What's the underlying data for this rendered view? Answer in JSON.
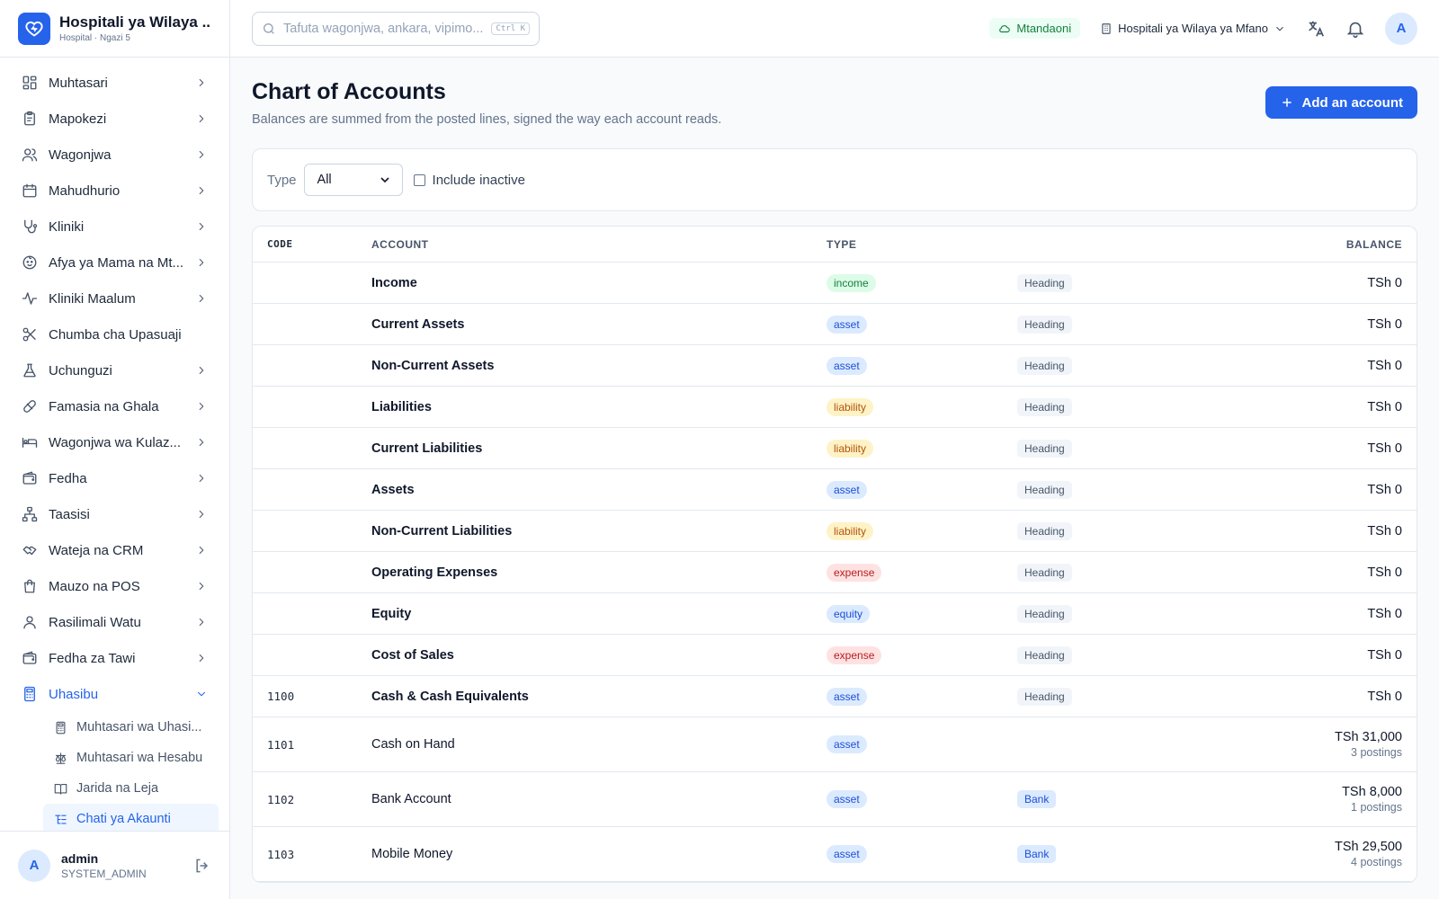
{
  "brand": {
    "title": "Hospitali ya Wilaya ...",
    "subtitle": "Hospital · Ngazi 5"
  },
  "sidebar": {
    "items": [
      {
        "label": "Muhtasari",
        "icon": "dashboard-icon",
        "chevron": true
      },
      {
        "label": "Mapokezi",
        "icon": "clipboard-icon",
        "chevron": true
      },
      {
        "label": "Wagonjwa",
        "icon": "users-icon",
        "chevron": true
      },
      {
        "label": "Mahudhurio",
        "icon": "calendar-icon",
        "chevron": true
      },
      {
        "label": "Kliniki",
        "icon": "stethoscope-icon",
        "chevron": true
      },
      {
        "label": "Afya ya Mama na Mt...",
        "icon": "baby-icon",
        "chevron": true
      },
      {
        "label": "Kliniki Maalum",
        "icon": "activity-icon",
        "chevron": true
      },
      {
        "label": "Chumba cha Upasuaji",
        "icon": "scissors-icon",
        "chevron": false
      },
      {
        "label": "Uchunguzi",
        "icon": "flask-icon",
        "chevron": true
      },
      {
        "label": "Famasia na Ghala",
        "icon": "pill-icon",
        "chevron": true
      },
      {
        "label": "Wagonjwa wa Kulaz...",
        "icon": "bed-icon",
        "chevron": true
      },
      {
        "label": "Fedha",
        "icon": "wallet-icon",
        "chevron": true
      },
      {
        "label": "Taasisi",
        "icon": "org-chart-icon",
        "chevron": true
      },
      {
        "label": "Wateja na CRM",
        "icon": "handshake-icon",
        "chevron": true
      },
      {
        "label": "Mauzo na POS",
        "icon": "shopping-bag-icon",
        "chevron": true
      },
      {
        "label": "Rasilimali Watu",
        "icon": "user-icon",
        "chevron": true
      },
      {
        "label": "Fedha za Tawi",
        "icon": "wallet-icon",
        "chevron": true
      },
      {
        "label": "Uhasibu",
        "icon": "calculator-icon",
        "chevron": true,
        "active": true
      }
    ],
    "subitems": [
      {
        "label": "Muhtasari wa Uhasi...",
        "icon": "calculator-icon"
      },
      {
        "label": "Muhtasari wa Hesabu",
        "icon": "scale-icon"
      },
      {
        "label": "Jarida na Leja",
        "icon": "book-icon"
      },
      {
        "label": "Chati ya Akaunti",
        "icon": "list-tree-icon",
        "active": true
      }
    ]
  },
  "user": {
    "initial": "A",
    "name": "admin",
    "role": "SYSTEM_ADMIN"
  },
  "topbar": {
    "search_placeholder": "Tafuta wagonjwa, ankara, vipimo...",
    "shortcut": "Ctrl K",
    "status": "Mtandaoni",
    "facility": "Hospitali ya Wilaya ya Mfano",
    "avatar": "A"
  },
  "page": {
    "title": "Chart of Accounts",
    "subtitle": "Balances are summed from the posted lines, signed the way each account reads.",
    "add_button": "Add an account"
  },
  "filters": {
    "type_label": "Type",
    "type_value": "All",
    "include_inactive": "Include inactive"
  },
  "table": {
    "headers": {
      "code": "CODE",
      "account": "ACCOUNT",
      "type": "TYPE",
      "balance": "BALANCE"
    },
    "rows": [
      {
        "code": "",
        "account": "Income",
        "type": "income",
        "tag": "Heading",
        "balance": "TSh 0",
        "postings": "",
        "heading": true
      },
      {
        "code": "",
        "account": "Current Assets",
        "type": "asset",
        "tag": "Heading",
        "balance": "TSh 0",
        "postings": "",
        "heading": true
      },
      {
        "code": "",
        "account": "Non-Current Assets",
        "type": "asset",
        "tag": "Heading",
        "balance": "TSh 0",
        "postings": "",
        "heading": true
      },
      {
        "code": "",
        "account": "Liabilities",
        "type": "liability",
        "tag": "Heading",
        "balance": "TSh 0",
        "postings": "",
        "heading": true
      },
      {
        "code": "",
        "account": "Current Liabilities",
        "type": "liability",
        "tag": "Heading",
        "balance": "TSh 0",
        "postings": "",
        "heading": true
      },
      {
        "code": "",
        "account": "Assets",
        "type": "asset",
        "tag": "Heading",
        "balance": "TSh 0",
        "postings": "",
        "heading": true
      },
      {
        "code": "",
        "account": "Non-Current Liabilities",
        "type": "liability",
        "tag": "Heading",
        "balance": "TSh 0",
        "postings": "",
        "heading": true
      },
      {
        "code": "",
        "account": "Operating Expenses",
        "type": "expense",
        "tag": "Heading",
        "balance": "TSh 0",
        "postings": "",
        "heading": true
      },
      {
        "code": "",
        "account": "Equity",
        "type": "equity",
        "tag": "Heading",
        "balance": "TSh 0",
        "postings": "",
        "heading": true
      },
      {
        "code": "",
        "account": "Cost of Sales",
        "type": "expense",
        "tag": "Heading",
        "balance": "TSh 0",
        "postings": "",
        "heading": true
      },
      {
        "code": "1100",
        "account": "Cash & Cash Equivalents",
        "type": "asset",
        "tag": "Heading",
        "balance": "TSh 0",
        "postings": "",
        "heading": true
      },
      {
        "code": "1101",
        "account": "Cash on Hand",
        "type": "asset",
        "tag": "",
        "balance": "TSh 31,000",
        "postings": "3 postings",
        "heading": false
      },
      {
        "code": "1102",
        "account": "Bank Account",
        "type": "asset",
        "tag": "Bank",
        "balance": "TSh 8,000",
        "postings": "1 postings",
        "heading": false
      },
      {
        "code": "1103",
        "account": "Mobile Money",
        "type": "asset",
        "tag": "Bank",
        "balance": "TSh 29,500",
        "postings": "4 postings",
        "heading": false
      }
    ]
  },
  "colors": {
    "accent": "#2563eb",
    "income": "#15803d",
    "asset": "#1d4ed8",
    "liability": "#b45309",
    "expense": "#b91c1c"
  }
}
